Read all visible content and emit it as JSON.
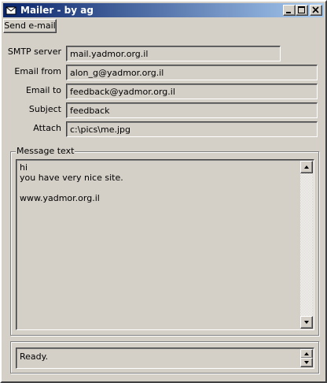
{
  "window": {
    "title": "Mailer - by ag"
  },
  "toolbar": {
    "send_label": "Send e-mail"
  },
  "form": {
    "smtp_label": "SMTP server",
    "smtp_value": "mail.yadmor.org.il",
    "from_label": "Email from",
    "from_value": "alon_g@yadmor.org.il",
    "to_label": "Email to",
    "to_value": "feedback@yadmor.org.il",
    "subject_label": "Subject",
    "subject_value": "feedback",
    "attach_label": "Attach",
    "attach_value": "c:\\pics\\me.jpg"
  },
  "message": {
    "group_label": "Message text",
    "lines": [
      "hi",
      "you have very nice site.",
      "",
      "www.yadmor.org.il"
    ]
  },
  "status": {
    "text": "Ready."
  },
  "icons": {
    "app": "mail-app-icon",
    "minimize": "minimize-icon",
    "maximize": "maximize-icon",
    "close": "close-icon",
    "scroll_up": "arrow-up-icon",
    "scroll_down": "arrow-down-icon"
  },
  "colors": {
    "title_start": "#0a246a",
    "title_end": "#a6caf0",
    "face": "#d4d0c8"
  }
}
